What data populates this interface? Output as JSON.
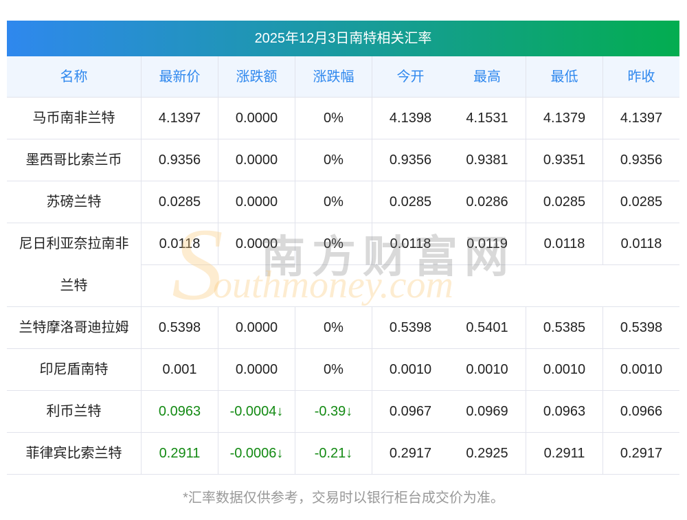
{
  "title": "2025年12月3日南特相关汇率",
  "columns": [
    "名称",
    "最新价",
    "涨跌额",
    "涨跌幅",
    "今开",
    "最高",
    "最低",
    "昨收"
  ],
  "rows": [
    {
      "name": "马币南非兰特",
      "values": [
        "4.1397",
        "0.0000",
        "0%",
        "4.1398",
        "4.1531",
        "4.1379",
        "4.1397"
      ],
      "down": false
    },
    {
      "name": "墨西哥比索兰币",
      "values": [
        "0.9356",
        "0.0000",
        "0%",
        "0.9356",
        "0.9381",
        "0.9351",
        "0.9356"
      ],
      "down": false
    },
    {
      "name": "苏磅兰特",
      "values": [
        "0.0285",
        "0.0000",
        "0%",
        "0.0285",
        "0.0286",
        "0.0285",
        "0.0285"
      ],
      "down": false
    },
    {
      "name": "尼日利亚奈拉南非",
      "name_line2": "兰特",
      "values": [
        "0.0118",
        "0.0000",
        "0%",
        "0.0118",
        "0.0119",
        "0.0118",
        "0.0118"
      ],
      "down": false
    },
    {
      "name": "兰特摩洛哥迪拉姆",
      "values": [
        "0.5398",
        "0.0000",
        "0%",
        "0.5398",
        "0.5401",
        "0.5385",
        "0.5398"
      ],
      "down": false
    },
    {
      "name": "印尼盾南特",
      "values": [
        "0.001",
        "0.0000",
        "0%",
        "0.0010",
        "0.0010",
        "0.0010",
        "0.0010"
      ],
      "down": false
    },
    {
      "name": "利币兰特",
      "values": [
        "0.0963",
        "-0.0004↓",
        "-0.39↓",
        "0.0967",
        "0.0969",
        "0.0963",
        "0.0966"
      ],
      "down": true
    },
    {
      "name": "菲律宾比索兰特",
      "values": [
        "0.2911",
        "-0.0006↓",
        "-0.21↓",
        "0.2917",
        "0.2925",
        "0.2911",
        "0.2917"
      ],
      "down": true
    }
  ],
  "footer": "*汇率数据仅供参考，交易时以银行柜台成交价为准。",
  "watermark": {
    "cn": "南方财富网",
    "en": "outhmoney.com",
    "s": "S"
  },
  "colors": {
    "accent": "#2f88ee",
    "down": "#138a13",
    "gradient_end": "#03ad50"
  }
}
